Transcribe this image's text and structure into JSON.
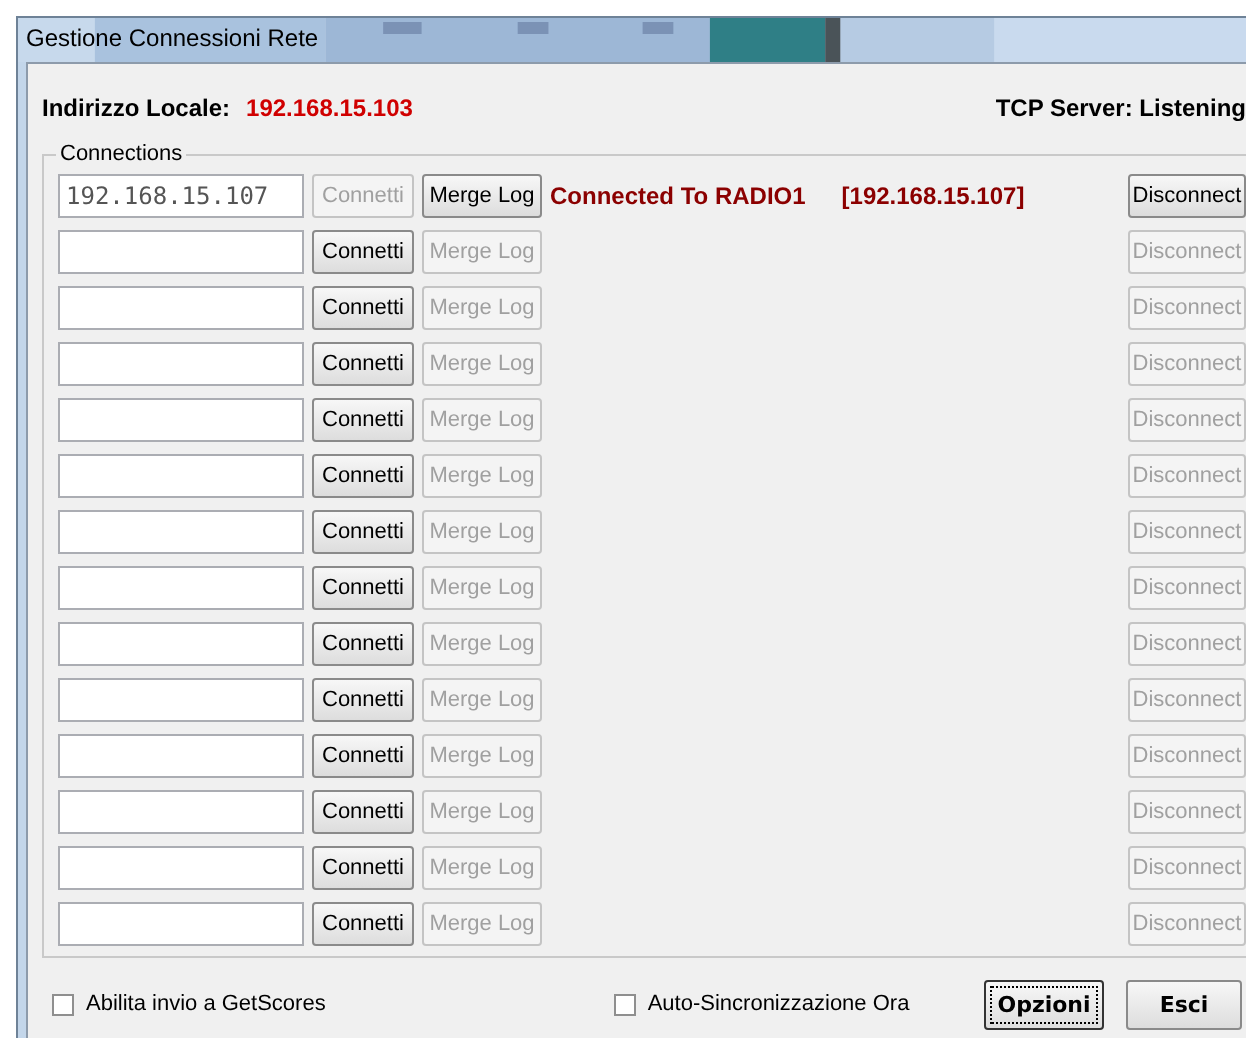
{
  "window": {
    "title": "Gestione Connessioni Rete"
  },
  "local_address": {
    "label": "Indirizzo Locale:",
    "value": "192.168.15.103"
  },
  "server_status": "TCP Server: Listening",
  "connections": {
    "title": "Connections",
    "rows": [
      {
        "address": "192.168.15.107",
        "connect": {
          "label": "Connetti",
          "disabled": true
        },
        "merge": {
          "label": "Merge Log",
          "disabled": false
        },
        "status": "Connected To RADIO1",
        "status_address": "[192.168.15.107]",
        "disconnect": {
          "label": "Disconnect",
          "disabled": false
        }
      },
      {
        "connect": {
          "label": "Connetti",
          "disabled": false
        },
        "merge": {
          "label": "Merge Log",
          "disabled": true
        },
        "disconnect": {
          "label": "Disconnect",
          "disabled": true
        }
      },
      {
        "connect": {
          "label": "Connetti",
          "disabled": false
        },
        "merge": {
          "label": "Merge Log",
          "disabled": true
        },
        "disconnect": {
          "label": "Disconnect",
          "disabled": true
        }
      },
      {
        "connect": {
          "label": "Connetti",
          "disabled": false
        },
        "merge": {
          "label": "Merge Log",
          "disabled": true
        },
        "disconnect": {
          "label": "Disconnect",
          "disabled": true
        }
      },
      {
        "connect": {
          "label": "Connetti",
          "disabled": false
        },
        "merge": {
          "label": "Merge Log",
          "disabled": true
        },
        "disconnect": {
          "label": "Disconnect",
          "disabled": true
        }
      },
      {
        "connect": {
          "label": "Connetti",
          "disabled": false
        },
        "merge": {
          "label": "Merge Log",
          "disabled": true
        },
        "disconnect": {
          "label": "Disconnect",
          "disabled": true
        }
      },
      {
        "connect": {
          "label": "Connetti",
          "disabled": false
        },
        "merge": {
          "label": "Merge Log",
          "disabled": true
        },
        "disconnect": {
          "label": "Disconnect",
          "disabled": true
        }
      },
      {
        "connect": {
          "label": "Connetti",
          "disabled": false
        },
        "merge": {
          "label": "Merge Log",
          "disabled": true
        },
        "disconnect": {
          "label": "Disconnect",
          "disabled": true
        }
      },
      {
        "connect": {
          "label": "Connetti",
          "disabled": false
        },
        "merge": {
          "label": "Merge Log",
          "disabled": true
        },
        "disconnect": {
          "label": "Disconnect",
          "disabled": true
        }
      },
      {
        "connect": {
          "label": "Connetti",
          "disabled": false
        },
        "merge": {
          "label": "Merge Log",
          "disabled": true
        },
        "disconnect": {
          "label": "Disconnect",
          "disabled": true
        }
      },
      {
        "connect": {
          "label": "Connetti",
          "disabled": false
        },
        "merge": {
          "label": "Merge Log",
          "disabled": true
        },
        "disconnect": {
          "label": "Disconnect",
          "disabled": true
        }
      },
      {
        "connect": {
          "label": "Connetti",
          "disabled": false
        },
        "merge": {
          "label": "Merge Log",
          "disabled": true
        },
        "disconnect": {
          "label": "Disconnect",
          "disabled": true
        }
      },
      {
        "connect": {
          "label": "Connetti",
          "disabled": false
        },
        "merge": {
          "label": "Merge Log",
          "disabled": true
        },
        "disconnect": {
          "label": "Disconnect",
          "disabled": true
        }
      },
      {
        "connect": {
          "label": "Connetti",
          "disabled": false
        },
        "merge": {
          "label": "Merge Log",
          "disabled": true
        },
        "disconnect": {
          "label": "Disconnect",
          "disabled": true
        }
      }
    ]
  },
  "options": [
    {
      "label": "Abilita invio a GetScores",
      "checked": false
    },
    {
      "label": "Auto-Sincronizzazione Ora",
      "checked": false
    }
  ],
  "buttons": [
    {
      "label": "Opzioni",
      "focused": true
    },
    {
      "label": "Esci",
      "focused": false
    }
  ]
}
